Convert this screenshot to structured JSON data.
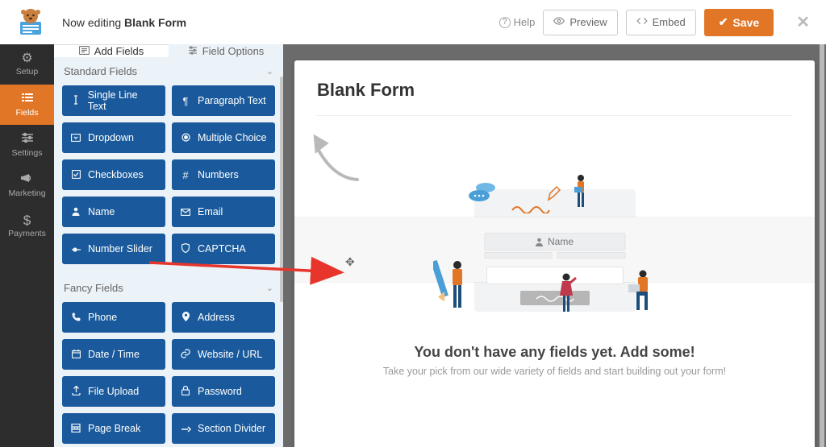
{
  "header": {
    "editing_prefix": "Now editing ",
    "form_name": "Blank Form",
    "help_label": "Help",
    "preview_label": "Preview",
    "embed_label": "Embed",
    "save_label": "Save"
  },
  "rail": {
    "setup": "Setup",
    "fields": "Fields",
    "settings": "Settings",
    "marketing": "Marketing",
    "payments": "Payments"
  },
  "tabs": {
    "add_fields": "Add Fields",
    "field_options": "Field Options"
  },
  "sections": {
    "standard": "Standard Fields",
    "fancy": "Fancy Fields"
  },
  "standard_fields": {
    "single_line": "Single Line Text",
    "paragraph": "Paragraph Text",
    "dropdown": "Dropdown",
    "multiple_choice": "Multiple Choice",
    "checkboxes": "Checkboxes",
    "numbers": "Numbers",
    "name": "Name",
    "email": "Email",
    "number_slider": "Number Slider",
    "captcha": "CAPTCHA"
  },
  "fancy_fields": {
    "phone": "Phone",
    "address": "Address",
    "datetime": "Date / Time",
    "website": "Website / URL",
    "file_upload": "File Upload",
    "password": "Password",
    "page_break": "Page Break",
    "section_divider": "Section Divider"
  },
  "canvas": {
    "title": "Blank Form",
    "drop_chip": "Name",
    "empty_heading": "You don't have any fields yet. Add some!",
    "empty_sub": "Take your pick from our wide variety of fields and start building out your form!"
  }
}
